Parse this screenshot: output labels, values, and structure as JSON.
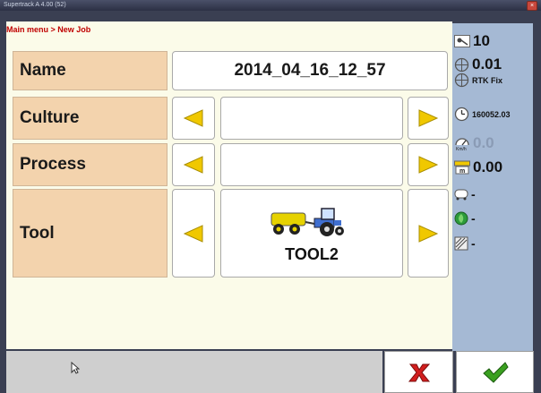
{
  "window": {
    "title": "Supertrack A 4.00 (52)",
    "close_glyph": "×"
  },
  "breadcrumb": "Main menu > New Job",
  "rows": {
    "name": {
      "label": "Name",
      "value": "2014_04_16_12_57"
    },
    "culture": {
      "label": "Culture",
      "value": ""
    },
    "process": {
      "label": "Process",
      "value": ""
    },
    "tool": {
      "label": "Tool",
      "value": "TOOL2",
      "icon": "tractor-tool-icon"
    }
  },
  "status": {
    "satellites": "10",
    "precision": "0.01",
    "fix": "RTK Fix",
    "time": "160052.03",
    "speed": "0.0",
    "distance": "0.00",
    "s1": "-",
    "s2": "-",
    "s3": "-"
  },
  "colors": {
    "accent_arrow": "#f0c800",
    "label_bg": "#f3d3ad",
    "side_bg": "#a5b9d4",
    "cancel": "#d21e1e",
    "ok": "#3aa020"
  },
  "icons": [
    "satellite-icon",
    "crosshair-icon",
    "rtk-icon",
    "clock-icon",
    "speedometer-icon",
    "ruler-icon",
    "tank-icon",
    "plant-icon",
    "pattern-icon",
    "cursor-icon",
    "cancel-icon",
    "ok-icon",
    "arrow-left-icon",
    "arrow-right-icon"
  ]
}
